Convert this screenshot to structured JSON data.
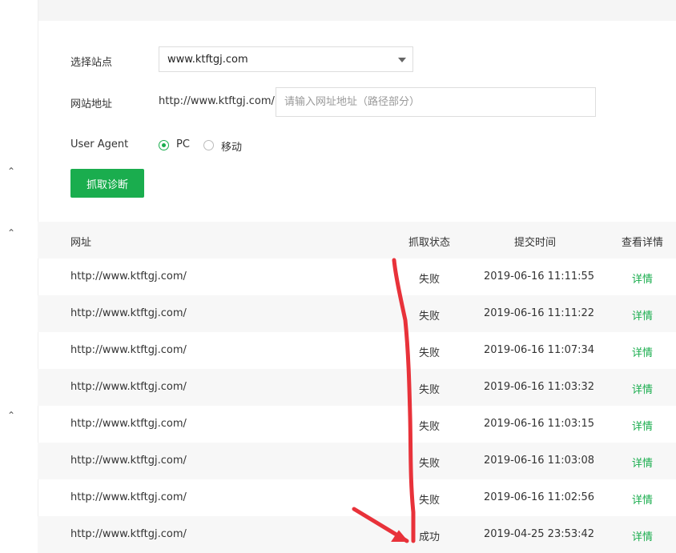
{
  "form": {
    "site_label": "选择站点",
    "site_value": "www.ktftgj.com",
    "address_label": "网站地址",
    "address_prefix": "http://www.ktftgj.com/",
    "address_placeholder": "请输入网址地址（路径部分）",
    "ua_label": "User Agent",
    "ua_options": [
      {
        "label": "PC",
        "selected": true
      },
      {
        "label": "移动",
        "selected": false
      }
    ],
    "submit_label": "抓取诊断"
  },
  "table": {
    "headers": {
      "url": "网址",
      "status": "抓取状态",
      "time": "提交时间",
      "detail": "查看详情"
    },
    "rows": [
      {
        "url": "http://www.ktftgj.com/",
        "status": "失败",
        "time": "2019-06-16 11:11:55",
        "detail": "详情"
      },
      {
        "url": "http://www.ktftgj.com/",
        "status": "失败",
        "time": "2019-06-16 11:11:22",
        "detail": "详情"
      },
      {
        "url": "http://www.ktftgj.com/",
        "status": "失败",
        "time": "2019-06-16 11:07:34",
        "detail": "详情"
      },
      {
        "url": "http://www.ktftgj.com/",
        "status": "失败",
        "time": "2019-06-16 11:03:32",
        "detail": "详情"
      },
      {
        "url": "http://www.ktftgj.com/",
        "status": "失败",
        "time": "2019-06-16 11:03:15",
        "detail": "详情"
      },
      {
        "url": "http://www.ktftgj.com/",
        "status": "失败",
        "time": "2019-06-16 11:03:08",
        "detail": "详情"
      },
      {
        "url": "http://www.ktftgj.com/",
        "status": "失败",
        "time": "2019-06-16 11:02:56",
        "detail": "详情"
      },
      {
        "url": "http://www.ktftgj.com/",
        "status": "成功",
        "time": "2019-04-25 23:53:42",
        "detail": "详情"
      }
    ]
  },
  "sidebar": {
    "chevrons": [
      "chevron-up-icon",
      "chevron-up-icon",
      "chevron-up-icon"
    ]
  },
  "colors": {
    "accent": "#1aad4e",
    "annotation": "#e8323a"
  }
}
